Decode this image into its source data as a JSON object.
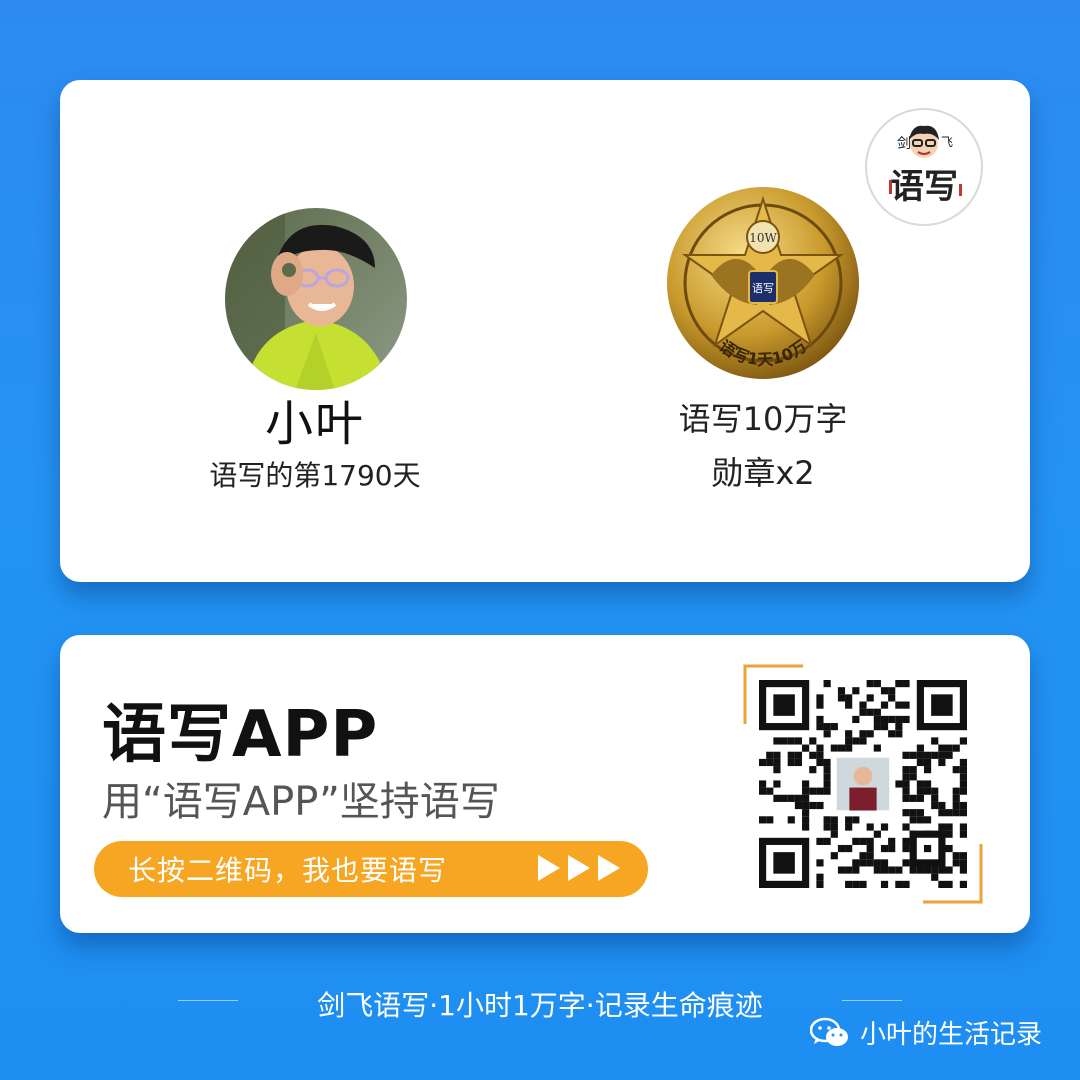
{
  "brand": {
    "logo_icon": "jianfei-yuxie-logo",
    "logo_text_top_left": "剑",
    "logo_text_top_right": "飞",
    "logo_text_main": "语写"
  },
  "profile": {
    "avatar_icon": "user-avatar",
    "name": "小叶",
    "days": "语写的第1790天"
  },
  "medal": {
    "icon": "medal-10w-badge",
    "badge_label": "10W",
    "ring_text": "语写1天10万",
    "shield_text": "语写",
    "title": "语写10万字",
    "count": "勋章x2"
  },
  "app_promo": {
    "app_name": "语写APP",
    "slogan": "用“语写APP”坚持语写",
    "cta_label": "长按二维码，我也要语写",
    "cta_arrow_icon": "triple-play-arrow-icon",
    "qr_icon": "qr-code"
  },
  "footer": {
    "tagline": "剑飞语写·1小时1万字·记录生命痕迹",
    "wechat_icon": "wechat-icon",
    "account_name": "小叶的生活记录"
  },
  "colors": {
    "background": "#2393f2",
    "cta": "#f6a623",
    "qr_accent": "#e8a33a"
  }
}
